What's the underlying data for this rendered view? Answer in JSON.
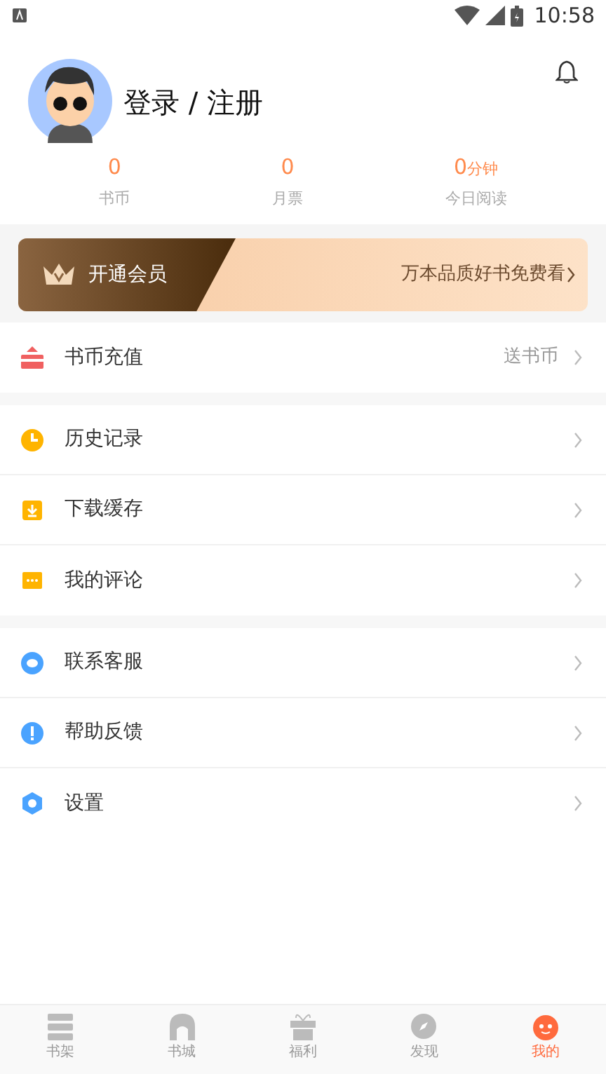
{
  "status_bar": {
    "time": "10:58"
  },
  "profile": {
    "name": "登录 / 注册"
  },
  "stats": [
    {
      "value": "0",
      "label": "书币"
    },
    {
      "value": "0",
      "label": "月票"
    },
    {
      "value": "0",
      "unit": "分钟",
      "label": "今日阅读"
    }
  ],
  "vip_banner": {
    "title": "开通会员",
    "promo": "万本品质好书免费看"
  },
  "menu_groups": [
    {
      "items": [
        {
          "label": "书币充值",
          "detail": "送书币"
        }
      ]
    },
    {
      "items": [
        {
          "label": "历史记录"
        },
        {
          "label": "下载缓存"
        },
        {
          "label": "我的评论"
        }
      ]
    },
    {
      "items": [
        {
          "label": "联系客服"
        },
        {
          "label": "帮助反馈"
        },
        {
          "label": "设置"
        }
      ]
    }
  ],
  "tab_bar": [
    {
      "label": "书架",
      "selected": false
    },
    {
      "label": "书城",
      "selected": false
    },
    {
      "label": "福利",
      "selected": false
    },
    {
      "label": "发现",
      "selected": false
    },
    {
      "label": "我的",
      "selected": true
    }
  ]
}
